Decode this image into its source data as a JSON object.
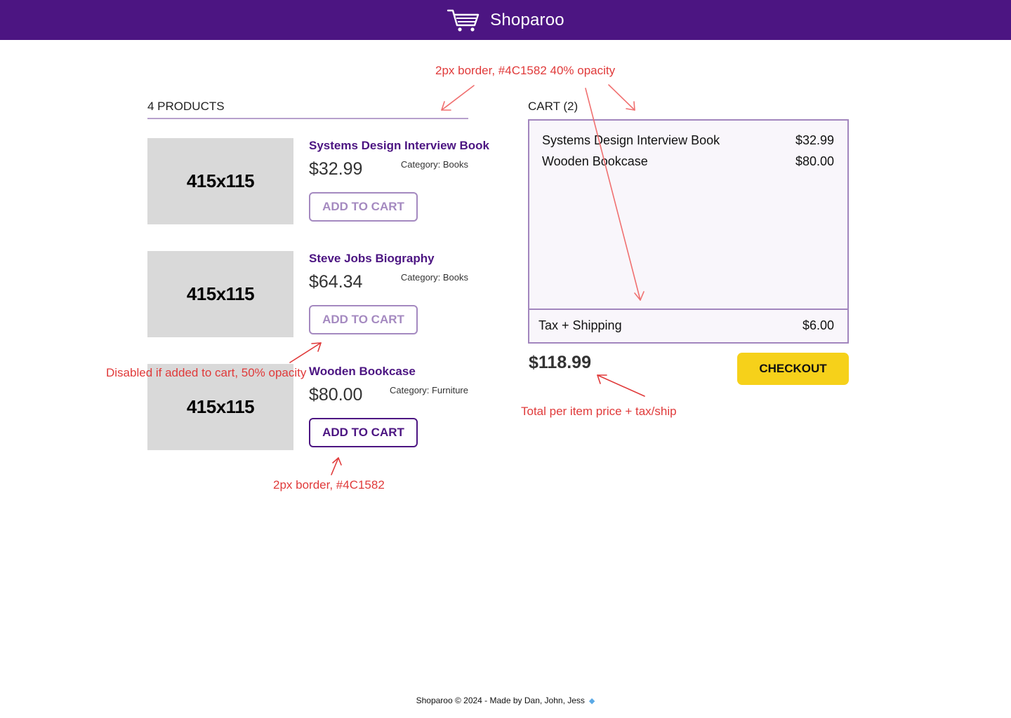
{
  "header": {
    "brand": "Shoparoo",
    "cart_icon": "shopping-cart-icon",
    "background": "#4C1582"
  },
  "products_section": {
    "title": "4 PRODUCTS",
    "items": [
      {
        "name": "Systems Design Interview Book",
        "price": "$32.99",
        "category": "Category: Books",
        "image_label": "415x115",
        "button": "ADD TO CART",
        "disabled": true
      },
      {
        "name": "Steve Jobs Biography",
        "price": "$64.34",
        "category": "Category: Books",
        "image_label": "415x115",
        "button": "ADD TO CART",
        "disabled": true
      },
      {
        "name": "Wooden Bookcase",
        "price": "$80.00",
        "category": "Category: Furniture",
        "image_label": "415x115",
        "button": "ADD TO CART",
        "disabled": false
      }
    ]
  },
  "cart": {
    "title": "CART (2)",
    "items": [
      {
        "name": "Systems Design Interview Book",
        "price": "$32.99"
      },
      {
        "name": "Wooden Bookcase",
        "price": "$80.00"
      }
    ],
    "tax_label": "Tax + Shipping",
    "tax_value": "$6.00",
    "total": "$118.99",
    "checkout": "CHECKOUT"
  },
  "annotations": {
    "border_faded": "2px border,  #4C1582 40% opacity",
    "disabled_note": "Disabled if added to cart, 50% opacity",
    "border_solid": "2px border,  #4C1582",
    "total_note": "Total per item price + tax/ship"
  },
  "footer": {
    "text": "Shoparoo © 2024  -  Made by Dan, John, Jess",
    "icon": "gem-icon"
  },
  "colors": {
    "brand": "#4C1582",
    "accent": "#F6D11A",
    "annotation": "#E03A3A"
  }
}
